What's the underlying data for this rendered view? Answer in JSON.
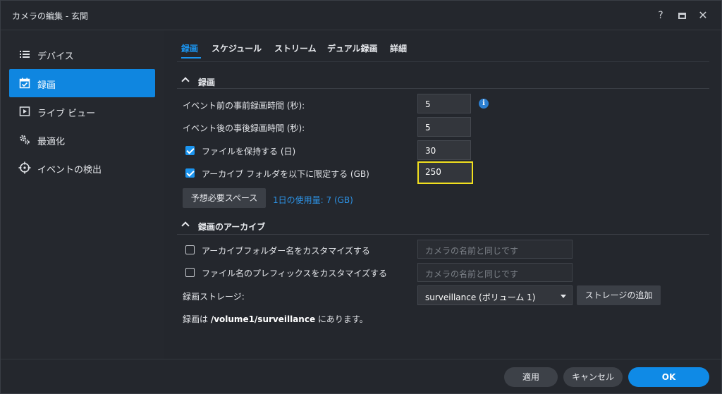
{
  "window": {
    "title": "カメラの編集 - 玄関",
    "help": "?"
  },
  "sidebar": {
    "items": [
      {
        "label": "デバイス"
      },
      {
        "label": "録画"
      },
      {
        "label": "ライブ ビュー"
      },
      {
        "label": "最適化"
      },
      {
        "label": "イベントの検出"
      }
    ]
  },
  "tabs": [
    "録画",
    "スケジュール",
    "ストリーム",
    "デュアル録画",
    "詳細"
  ],
  "recording": {
    "section_title": "録画",
    "pre_event_label": "イベント前の事前録画時間 (秒):",
    "pre_event_value": "5",
    "post_event_label": "イベント後の事後録画時間 (秒):",
    "post_event_value": "5",
    "keep_files_label": "ファイルを保持する (日)",
    "keep_files_value": "30",
    "limit_archive_label": "アーカイブ フォルダを以下に限定する (GB)",
    "limit_archive_value": "250",
    "estimate_button": "予想必要スペース",
    "usage_text": "1日の使用量: 7 (GB)"
  },
  "archive": {
    "section_title": "録画のアーカイブ",
    "custom_folder_label": "アーカイブフォルダー名をカスタマイズする",
    "custom_folder_placeholder": "カメラの名前と同じです",
    "custom_prefix_label": "ファイル名のプレフィックスをカスタマイズする",
    "custom_prefix_placeholder": "カメラの名前と同じです",
    "storage_label": "録画ストレージ:",
    "storage_value": "surveillance (ボリューム 1)",
    "add_storage_button": "ストレージの追加",
    "path_prefix": "録画は ",
    "path_value": "/volume1/surveillance",
    "path_suffix": " にあります。"
  },
  "footer": {
    "apply": "適用",
    "cancel": "キャンセル",
    "ok": "OK"
  },
  "colors": {
    "accent": "#0f86e0",
    "highlight": "#f2e01e",
    "background": "#24272d"
  }
}
